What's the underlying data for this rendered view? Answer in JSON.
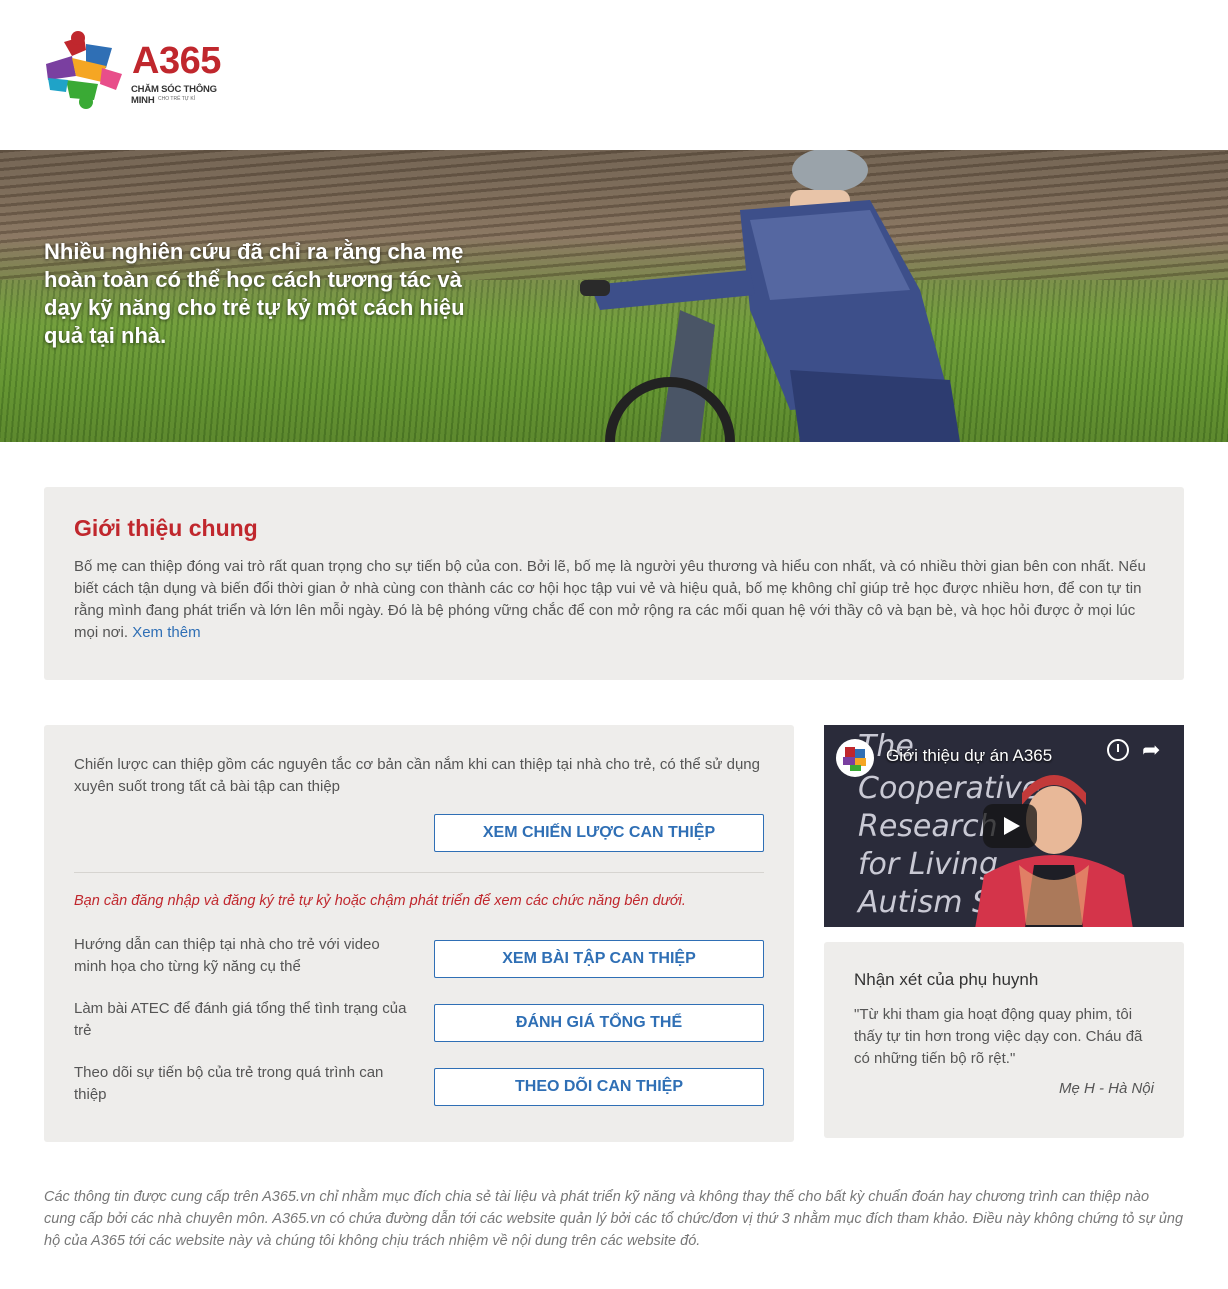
{
  "header": {
    "logo_text": "A365",
    "logo_tagline": "CHĂM SÓC THÔNG MINH",
    "logo_subtagline": "CHO TRẺ TỰ KỈ"
  },
  "hero": {
    "text": "Nhiều nghiên cứu đã chỉ ra rằng cha mẹ hoàn toàn có thể học cách tương tác và dạy kỹ năng cho trẻ tự kỷ một cách hiệu quả tại nhà."
  },
  "intro": {
    "title": "Giới thiệu chung",
    "body": "Bố mẹ can thiệp đóng vai trò rất quan trọng cho sự tiến bộ của con. Bởi lẽ, bố mẹ là người yêu thương và hiểu con nhất, và có nhiều thời gian bên con nhất. Nếu biết cách tận dụng và biến đổi thời gian ở nhà cùng con thành các cơ hội học tập vui vẻ và hiệu quả, bố mẹ không chỉ giúp trẻ học được nhiều hơn, để con tự tin rằng mình đang phát triển và lớn lên mỗi ngày. Đó là bệ phóng vững chắc để con mở rộng ra các mối quan hệ với thầy cô và bạn bè, và học hỏi được ở mọi lúc mọi nơi.",
    "more_link": "Xem thêm"
  },
  "strategy": {
    "description": "Chiến lược can thiệp gồm các nguyên tắc cơ bản cần nắm khi can thiệp tại nhà cho trẻ, có thể sử dụng xuyên suốt trong tất cả bài tập can thiệp",
    "button": "XEM CHIẾN LƯỢC CAN THIỆP",
    "login_note": "Bạn cần đăng nhập và đăng ký trẻ tự kỷ hoặc chậm phát triển để xem các chức năng bên dưới.",
    "rows": [
      {
        "label": "Hướng dẫn can thiệp tại nhà cho trẻ với video minh họa cho từng kỹ năng cụ thể",
        "button": "XEM BÀI TẬP CAN THIỆP"
      },
      {
        "label": "Làm bài ATEC để đánh giá tổng thể tình trạng của trẻ",
        "button": "ĐÁNH GIÁ TỔNG THỂ"
      },
      {
        "label": "Theo dõi sự tiến bộ của trẻ trong quá trình can thiệp",
        "button": "THEO DÕI CAN THIỆP"
      }
    ]
  },
  "video": {
    "title": "Giới thiệu dự án A365",
    "bg_lines": [
      "The",
      "Cooperative",
      "Research",
      "for Living",
      "Autism S"
    ]
  },
  "testimonial": {
    "title": "Nhận xét của phụ huynh",
    "quote": "\"Từ khi tham gia hoạt động quay phim, tôi thấy tự tin hơn trong việc dạy con. Cháu đã có những tiến bộ rõ rệt.\"",
    "author": "Mẹ H - Hà Nội"
  },
  "footer": {
    "disclaimer": "Các thông tin được cung cấp trên A365.vn chỉ nhằm mục đích chia sẻ tài liệu và phát triển kỹ năng và không thay thế cho bất kỳ chuẩn đoán hay chương trình can thiệp nào cung cấp bởi các nhà chuyên môn. A365.vn có chứa đường dẫn tới các website quản lý bởi các tổ chức/đơn vị thứ 3 nhằm mục đích tham khảo. Điều này không chứng tỏ sự ủng hộ của A365 tới các website này và chúng tôi không chịu trách nhiệm về nội dung trên các website đó."
  },
  "colors": {
    "brand_red": "#c0272d",
    "link_blue": "#2f6fb5",
    "panel_bg": "#eeedeb"
  }
}
